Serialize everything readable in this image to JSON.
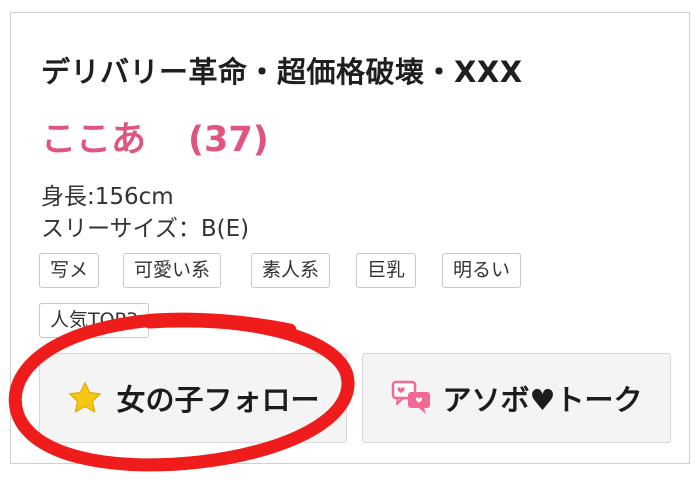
{
  "profile": {
    "shop_name": "デリバリー革命・超価格破壊・XXX",
    "girl_name": "ここあ",
    "age": "(37)",
    "height": "身長:156cm",
    "sizes": "スリーサイズ：B(E)"
  },
  "tags": [
    "写メ",
    "可愛い系",
    "素人系",
    "巨乳",
    "明るい",
    "人気TOP3"
  ],
  "buttons": {
    "follow_label": "女の子フォロー",
    "talk_label": "アソボ♥トーク"
  },
  "icons": {
    "follow": "star-icon",
    "talk": "chat-bubbles-icon"
  },
  "colors": {
    "name_pink": "#e0557f",
    "star_yellow": "#f6c813",
    "talk_icon_pink": "#f06a94",
    "annotation_red": "#ef1c1c"
  }
}
